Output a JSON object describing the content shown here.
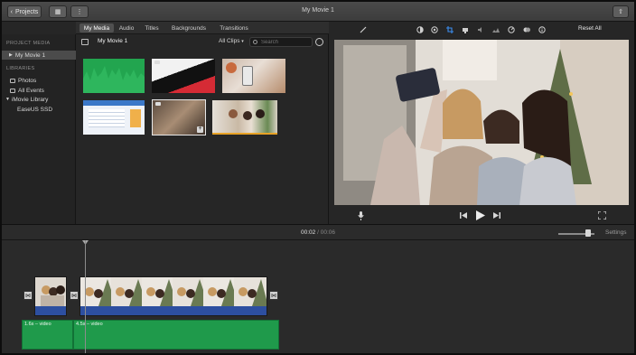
{
  "window": {
    "title": "My Movie 1",
    "projects_label": "Projects"
  },
  "tabs": [
    "My Media",
    "Audio",
    "Titles",
    "Backgrounds",
    "Transitions"
  ],
  "sidebar": {
    "project_media_heading": "PROJECT MEDIA",
    "project_item": "My Movie 1",
    "libraries_heading": "LIBRARIES",
    "library_items": [
      "Photos",
      "All Events"
    ],
    "library_name": "iMovie Library",
    "library_sub": "EaseUS SSD"
  },
  "browser": {
    "title": "My Movie 1",
    "clips_filter": "All Clips",
    "search_placeholder": "Search"
  },
  "viewer": {
    "reset_label": "Reset All"
  },
  "timeline": {
    "current_time": "00:02",
    "separator": "/",
    "total_time": "00:06",
    "settings_label": "Settings",
    "audio_clips": [
      "1.6s – video",
      "4.5s – video"
    ],
    "zoom_level": 0.75
  },
  "colors": {
    "accent_selected": "#4b4b4b",
    "audio_clip": "#1f9a4b",
    "video_clip_bar": "#2d4fa0",
    "crop_tool": "#3b8ef0"
  }
}
